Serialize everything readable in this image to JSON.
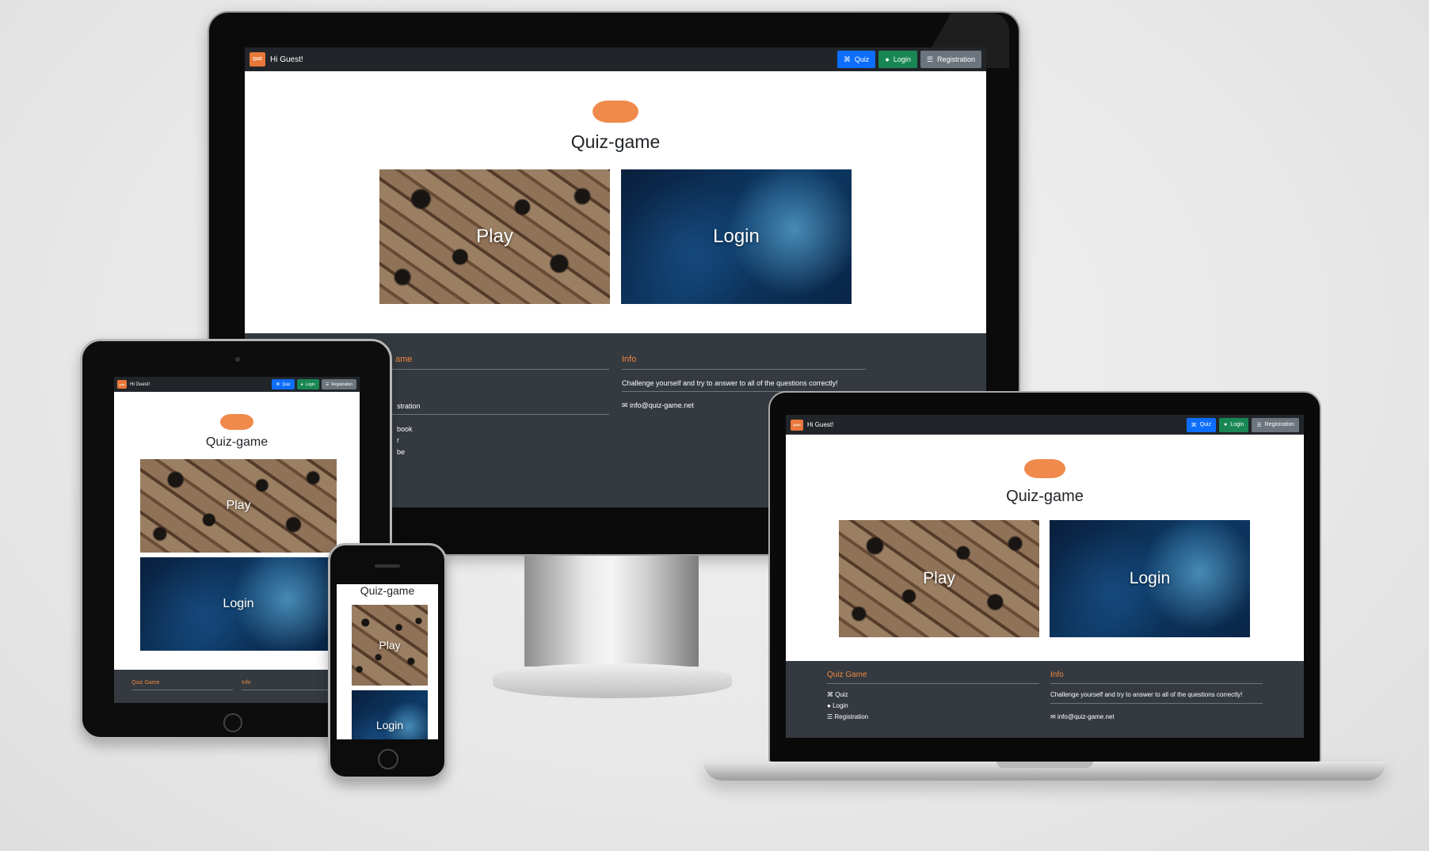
{
  "nav": {
    "logo_text": "QUIZ",
    "greeting": "Hi Guest!",
    "quiz_label": "Quiz",
    "login_label": "Login",
    "registration_label": "Registration"
  },
  "hero": {
    "title": "Quiz-game"
  },
  "tiles": {
    "play_label": "Play",
    "login_label": "Login"
  },
  "footer": {
    "col1_heading": "Quiz Game",
    "links": [
      "Quiz",
      "Login",
      "Registration"
    ],
    "social": [
      "Facebook",
      "Twitter",
      "Youtube"
    ],
    "social_visible": [
      "book",
      "r",
      "be"
    ],
    "registration_visible": "stration",
    "col1_heading_visible": "ame",
    "col2_heading": "Info",
    "info_text": "Challenge yourself and try to answer to all of the questions correctly!",
    "email": "info@quiz-game.net"
  },
  "colors": {
    "accent_orange": "#ef8a4c",
    "nav_dark": "#212529",
    "footer_dark": "#343a40",
    "quiz_blue": "#0d6efd",
    "login_green": "#198754",
    "registration_gray": "#6c757d"
  },
  "icons": [
    "gamepad-icon",
    "user-icon",
    "list-icon",
    "envelope-icon"
  ]
}
